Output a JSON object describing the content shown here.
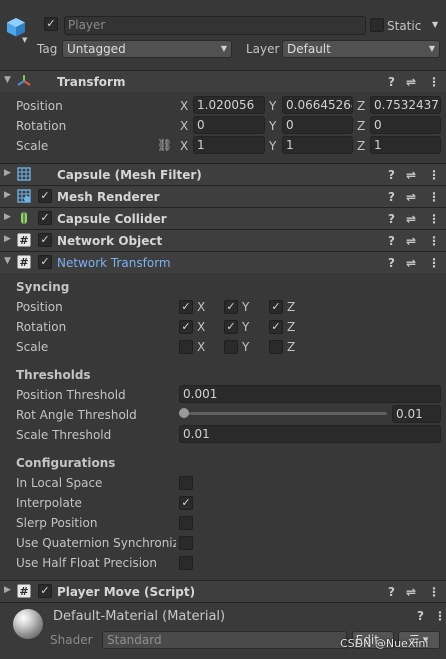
{
  "header": {
    "name_value": "Player",
    "static_label": "Static",
    "tag_label": "Tag",
    "tag_value": "Untagged",
    "layer_label": "Layer",
    "layer_value": "Default"
  },
  "transform": {
    "title": "Transform",
    "rows": [
      {
        "label": "Position",
        "x": "1.020056",
        "y": "0.06645264",
        "z": "0.7532437"
      },
      {
        "label": "Rotation",
        "x": "0",
        "y": "0",
        "z": "0"
      },
      {
        "label": "Scale",
        "x": "1",
        "y": "1",
        "z": "1"
      }
    ],
    "axis": {
      "x": "X",
      "y": "Y",
      "z": "Z"
    }
  },
  "components": {
    "mesh_filter": "Capsule (Mesh Filter)",
    "mesh_renderer": "Mesh Renderer",
    "capsule_collider": "Capsule Collider",
    "network_object": "Network Object",
    "network_transform": "Network Transform",
    "player_move": "Player Move (Script)"
  },
  "syncing": {
    "title": "Syncing",
    "rows": [
      {
        "label": "Position",
        "x": true,
        "y": true,
        "z": true
      },
      {
        "label": "Rotation",
        "x": true,
        "y": true,
        "z": true
      },
      {
        "label": "Scale",
        "x": false,
        "y": false,
        "z": false
      }
    ]
  },
  "thresholds": {
    "title": "Thresholds",
    "position_label": "Position Threshold",
    "position_value": "0.001",
    "rot_label": "Rot Angle Threshold",
    "rot_value": "0.01",
    "rot_slider_fraction": 0.0,
    "scale_label": "Scale Threshold",
    "scale_value": "0.01"
  },
  "configurations": {
    "title": "Configurations",
    "rows": [
      {
        "label": "In Local Space",
        "checked": false
      },
      {
        "label": "Interpolate",
        "checked": true
      },
      {
        "label": "Slerp Position",
        "checked": false
      },
      {
        "label": "Use Quaternion Synchroniza",
        "checked": false
      },
      {
        "label": "Use Half Float Precision",
        "checked": false
      }
    ]
  },
  "material": {
    "name": "Default-Material (Material)",
    "shader_label": "Shader",
    "shader_value": "Standard",
    "edit_label": "Edit...",
    "watermark": "CSDN @NueXini"
  },
  "colors": {
    "background": "#383838",
    "header": "#3e3e3e",
    "accent_blue": "#7cb1f0",
    "field": "#2a2a2a"
  }
}
